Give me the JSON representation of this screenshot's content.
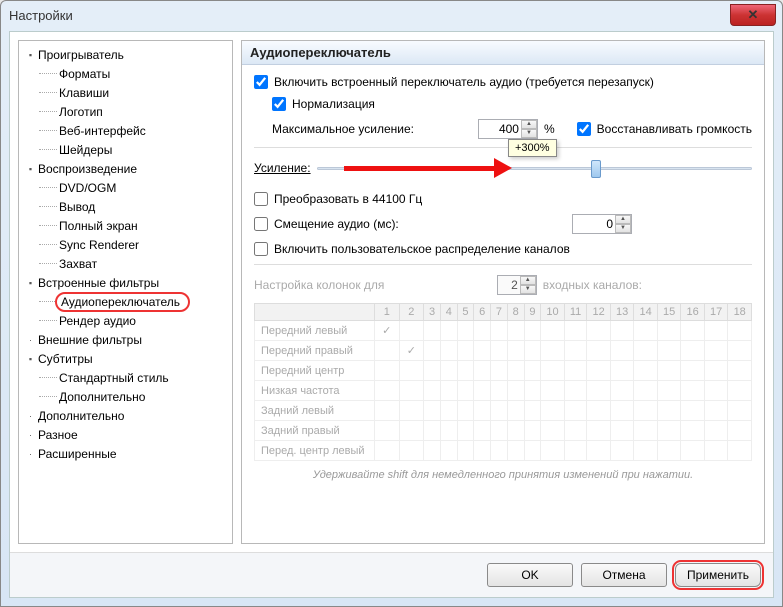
{
  "window": {
    "title": "Настройки"
  },
  "tree": [
    {
      "label": "Проигрыватель",
      "level": 1,
      "expander": "▾"
    },
    {
      "label": "Форматы",
      "level": 2
    },
    {
      "label": "Клавиши",
      "level": 2
    },
    {
      "label": "Логотип",
      "level": 2
    },
    {
      "label": "Веб-интерфейс",
      "level": 2
    },
    {
      "label": "Шейдеры",
      "level": 2
    },
    {
      "label": "Воспроизведение",
      "level": 1,
      "expander": "▾"
    },
    {
      "label": "DVD/OGM",
      "level": 2
    },
    {
      "label": "Вывод",
      "level": 2
    },
    {
      "label": "Полный экран",
      "level": 2
    },
    {
      "label": "Sync Renderer",
      "level": 2
    },
    {
      "label": "Захват",
      "level": 2
    },
    {
      "label": "Встроенные фильтры",
      "level": 1,
      "expander": "▾"
    },
    {
      "label": "Аудиопереключатель",
      "level": 2,
      "selected": true
    },
    {
      "label": "Рендер аудио",
      "level": 2
    },
    {
      "label": "Внешние фильтры",
      "level": 1,
      "expander": "·"
    },
    {
      "label": "Субтитры",
      "level": 1,
      "expander": "▾"
    },
    {
      "label": "Стандартный стиль",
      "level": 2
    },
    {
      "label": "Дополнительно",
      "level": 2
    },
    {
      "label": "Дополнительно",
      "level": 1,
      "expander": "·"
    },
    {
      "label": "Разное",
      "level": 1,
      "expander": "·"
    },
    {
      "label": "Расширенные",
      "level": 1,
      "expander": "·"
    }
  ],
  "panel": {
    "title": "Аудиопереключатель",
    "enable_builtin": "Включить встроенный переключатель аудио (требуется перезапуск)",
    "normalization": "Нормализация",
    "max_gain_label": "Максимальное усиление:",
    "max_gain_value": "400",
    "max_gain_unit": "%",
    "restore_volume": "Восстанавливать громкость",
    "gain_label": "Усиление:",
    "gain_tooltip": "+300%",
    "convert_44100": "Преобразовать в 44100 Гц",
    "audio_offset_label": "Смещение аудио (мс):",
    "audio_offset_value": "0",
    "custom_channels": "Включить пользовательское распределение каналов",
    "columns_label_prefix": "Настройка колонок для",
    "columns_value": "2",
    "columns_label_suffix": "входных каналов:",
    "channels": {
      "headers": [
        "1",
        "2",
        "3",
        "4",
        "5",
        "6",
        "7",
        "8",
        "9",
        "10",
        "11",
        "12",
        "13",
        "14",
        "15",
        "16",
        "17",
        "18"
      ],
      "rows": [
        {
          "name": "Передний левый",
          "tick": 1
        },
        {
          "name": "Передний правый",
          "tick": 2
        },
        {
          "name": "Передний центр",
          "tick": 0
        },
        {
          "name": "Низкая частота",
          "tick": 0
        },
        {
          "name": "Задний левый",
          "tick": 0
        },
        {
          "name": "Задний правый",
          "tick": 0
        },
        {
          "name": "Перед. центр левый",
          "tick": 0
        }
      ]
    },
    "hint": "Удерживайте shift для немедленного принятия изменений при нажатии."
  },
  "buttons": {
    "ok": "OK",
    "cancel": "Отмена",
    "apply": "Применить"
  }
}
